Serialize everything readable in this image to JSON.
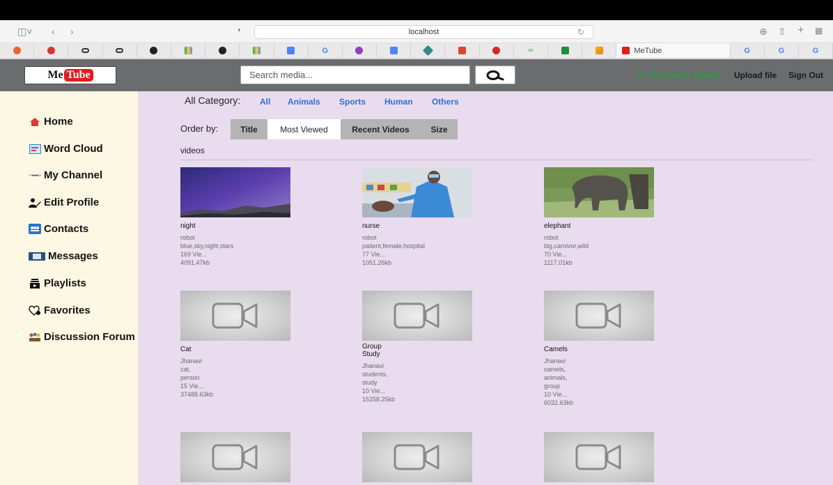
{
  "browser": {
    "address": "localhost",
    "active_tab_title": "MeTube",
    "tab_letters": [
      "G",
      "G",
      "G"
    ]
  },
  "header": {
    "logo_me": "Me",
    "logo_tube": "Tube",
    "search_placeholder": "Search media...",
    "user": "K_Prashanth_Reddy",
    "upload": "Upload file",
    "signout": "Sign Out"
  },
  "sidebar": {
    "items": [
      {
        "label": "Home",
        "icon": "home-icon"
      },
      {
        "label": "Word Cloud",
        "icon": "word-cloud-icon"
      },
      {
        "label": "My Channel",
        "icon": "channel-icon"
      },
      {
        "label": "Edit Profile",
        "icon": "edit-profile-icon"
      },
      {
        "label": "Contacts",
        "icon": "contacts-icon"
      },
      {
        "label": "Messages",
        "icon": "messages-icon"
      },
      {
        "label": "Playlists",
        "icon": "playlists-icon"
      },
      {
        "label": "Favorites",
        "icon": "favorites-icon"
      },
      {
        "label": "Discussion Forum",
        "icon": "forum-icon"
      }
    ]
  },
  "categories": {
    "label": "All Category:",
    "items": [
      "All",
      "Animals",
      "Sports",
      "Human",
      "Others"
    ]
  },
  "order": {
    "label": "Order by:",
    "options": [
      "Title",
      "Most Viewed",
      "Recent Videos",
      "Size"
    ],
    "selected": "Most Viewed"
  },
  "section_label": "videos",
  "videos": [
    {
      "title": "night",
      "owner": "robot",
      "tags": "blue,sky,night,stars",
      "views": "169 Vie...",
      "size": "4091.47kb"
    },
    {
      "title": "nurse",
      "owner": "robot",
      "tags": "patient,female,hospital",
      "views": "77 Vie...",
      "size": "1051.26kb"
    },
    {
      "title": "elephant",
      "owner": "robot",
      "tags": "big,carnivor,wild",
      "views": "70 Vie...",
      "size": "1117.01kb"
    },
    {
      "title": "Cat",
      "owner": "Jhanavi",
      "tags_lines": [
        "cat,",
        "person"
      ],
      "views": "15 Vie...",
      "size": "37488.63kb"
    },
    {
      "title_lines": [
        "Group",
        "Study"
      ],
      "owner": "Jhanavi",
      "tags_lines": [
        "students,",
        "study"
      ],
      "views": "10 Vie...",
      "size": "15258.25kb"
    },
    {
      "title": "Camels",
      "owner": "Jhanavi",
      "tags_lines": [
        "camels,",
        "animals,",
        "group"
      ],
      "views": "10 Vie...",
      "size": "6032.63kb"
    }
  ]
}
